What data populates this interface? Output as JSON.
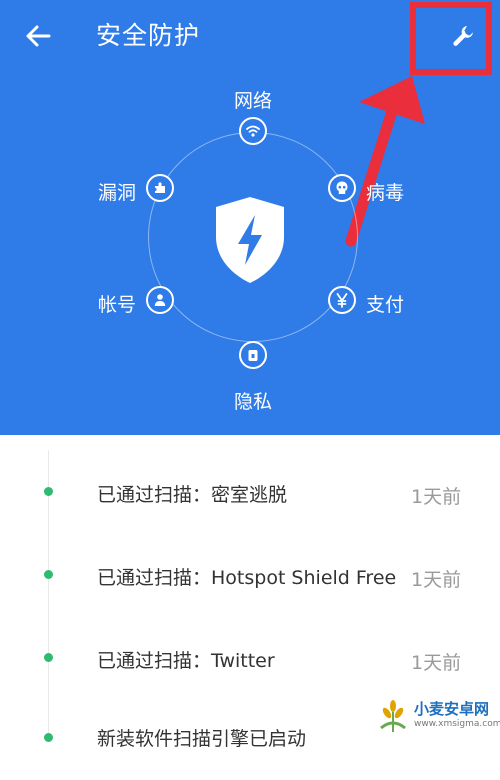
{
  "header": {
    "title": "安全防护"
  },
  "icons": {
    "back": "arrow-left-icon",
    "tools": "wrench-icon",
    "shield": "shield-lightning-icon"
  },
  "features": [
    {
      "label": "网络",
      "icon": "wifi-icon"
    },
    {
      "label": "病毒",
      "icon": "skull-icon"
    },
    {
      "label": "支付",
      "icon": "yen-icon"
    },
    {
      "label": "隐私",
      "icon": "lock-icon"
    },
    {
      "label": "帐号",
      "icon": "user-icon"
    },
    {
      "label": "漏洞",
      "icon": "puzzle-icon"
    }
  ],
  "scan_list": [
    {
      "text": "已通过扫描：密室逃脱",
      "time": "1天前"
    },
    {
      "text": "已通过扫描：Hotspot Shield Free",
      "time": "1天前"
    },
    {
      "text": "已通过扫描：Twitter",
      "time": "1天前"
    },
    {
      "text": "新装软件扫描引擎已启动",
      "time": ""
    }
  ],
  "watermark": {
    "title": "小麦安卓网",
    "url": "www.xmsigma.com"
  },
  "colors": {
    "header_bg": "#2f7be8",
    "annotation": "#ea2e3b",
    "status_dot": "#2dbb6f"
  }
}
